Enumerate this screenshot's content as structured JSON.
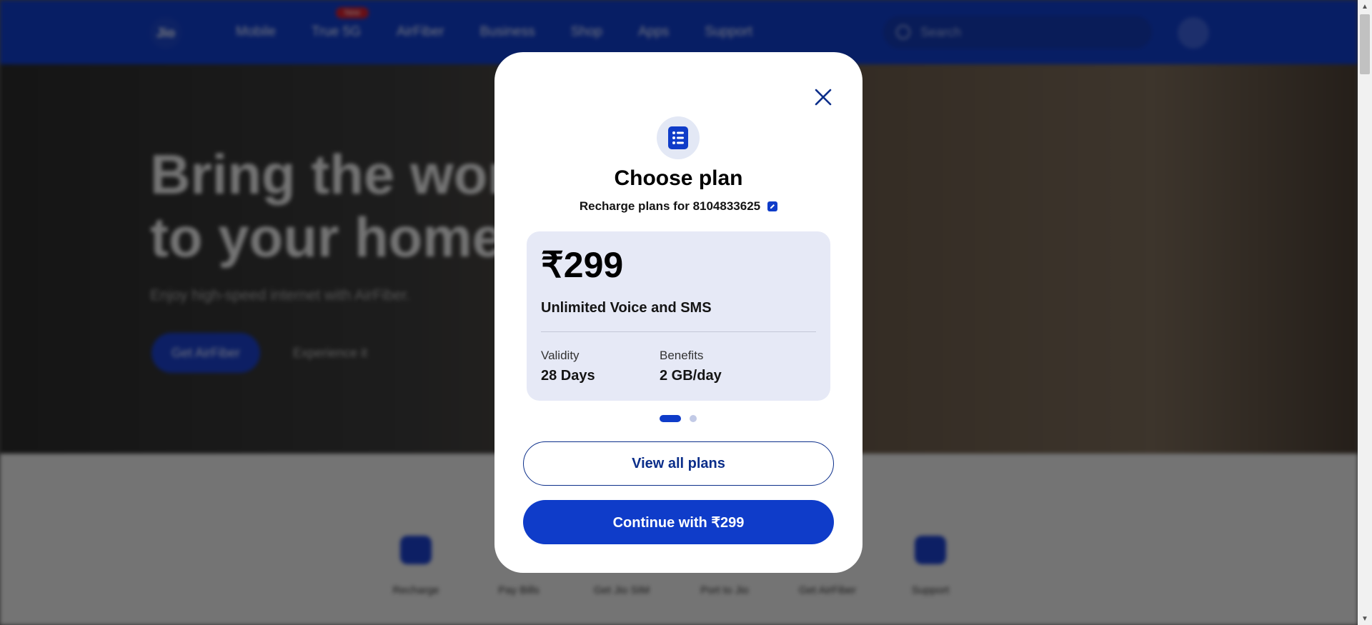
{
  "nav": {
    "logo": "Jio",
    "items": [
      "Mobile",
      "True 5G",
      "AirFiber",
      "Business",
      "Shop",
      "Apps",
      "Support"
    ],
    "badge": "New",
    "search_placeholder": "Search"
  },
  "hero": {
    "title_line1": "Bring the world",
    "title_line2": "to your home",
    "subtitle": "Enjoy high-speed internet with AirFiber.",
    "cta": "Get AirFiber",
    "link": "Experience it"
  },
  "quick_links": [
    "Recharge",
    "Pay Bills",
    "Get Jio SIM",
    "Port to Jio",
    "Get AirFiber",
    "Support"
  ],
  "modal": {
    "title": "Choose plan",
    "subtitle": "Recharge plans for 8104833625",
    "plan": {
      "price": "₹299",
      "description": "Unlimited Voice and SMS",
      "validity_label": "Validity",
      "validity_value": "28 Days",
      "benefits_label": "Benefits",
      "benefits_value": "2 GB/day"
    },
    "carousel_total": 2,
    "carousel_active": 1,
    "view_all_label": "View all plans",
    "continue_label": "Continue with ₹299"
  },
  "colors": {
    "brand_blue": "#0f3cc9",
    "navy_text": "#0b2e8a",
    "card_bg": "#e6e9f6"
  }
}
